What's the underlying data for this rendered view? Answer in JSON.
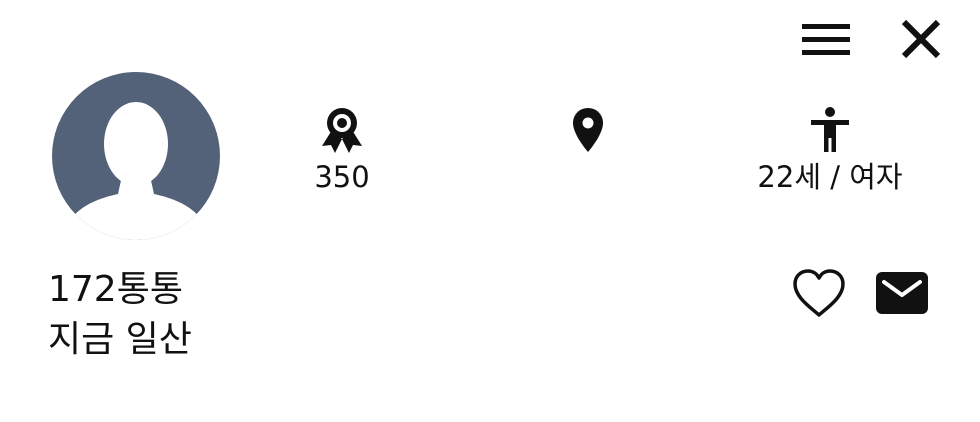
{
  "header": {
    "menu_icon": "hamburger-icon",
    "close_icon": "close-icon"
  },
  "profile": {
    "avatar_icon": "default-user-avatar",
    "avatar_color": "#536179",
    "nickname": "172통통",
    "status": "지금 일산"
  },
  "stats": {
    "points": {
      "icon": "award-ribbon-icon",
      "value": "350"
    },
    "location": {
      "icon": "map-pin-icon",
      "value": ""
    },
    "age_gender": {
      "icon": "person-icon",
      "value": "22세 / 여자"
    }
  },
  "actions": {
    "like_icon": "heart-outline-icon",
    "message_icon": "envelope-icon"
  }
}
